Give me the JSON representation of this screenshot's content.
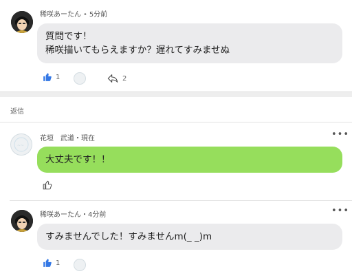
{
  "post": {
    "author": "稀咲あーたん",
    "time": "5分前",
    "line1": "質問です！",
    "line2": "稀咲描いてもらえますか？遅れてすみませぬ",
    "like_count": "1",
    "reply_count": "2"
  },
  "section": {
    "label": "返信"
  },
  "reply1": {
    "author": "花垣　武道・現在",
    "text": "大丈夫です！！",
    "more": "•••"
  },
  "reply2": {
    "author": "稀咲あーたん・4分前",
    "text": "すみませんでした！すみませんm(_ _)m",
    "more": "•••",
    "like_count": "1"
  },
  "colors": {
    "accent_blue": "#3478e5",
    "bubble_green": "#96de5c",
    "bubble_gray": "#ebebed"
  },
  "icons": [
    "thumbs-up-icon",
    "reply-icon",
    "more-icon"
  ]
}
